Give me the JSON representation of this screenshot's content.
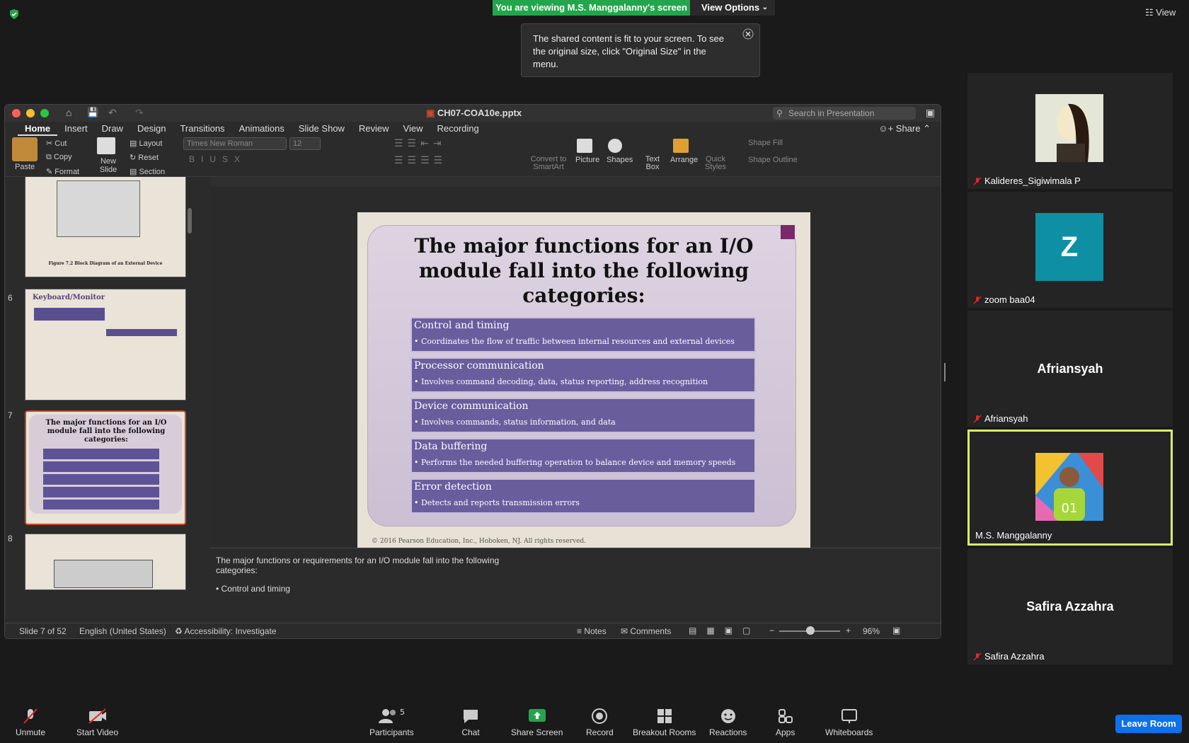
{
  "zoom": {
    "banner": "You are viewing M.S. Manggalanny's screen",
    "view_options": "View Options",
    "tip": "The shared content is fit to your screen. To see the original size, click \"Original Size\" in the menu.",
    "view": "View",
    "participants": [
      {
        "name": "Kalideres_Sigiwimala P",
        "type": "photo",
        "muted": true
      },
      {
        "name": "zoom baa04",
        "type": "letter",
        "letter": "Z",
        "color": "#0e8fa3",
        "muted": true
      },
      {
        "name": "Afriansyah",
        "type": "text",
        "muted": true
      },
      {
        "name": "M.S. Manggalanny",
        "type": "photo",
        "muted": false,
        "active": true
      },
      {
        "name": "Safira Azzahra",
        "type": "text",
        "muted": true
      }
    ],
    "toolbar": {
      "unmute": "Unmute",
      "start_video": "Start Video",
      "participants": "Participants",
      "participants_count": "5",
      "chat": "Chat",
      "share_screen": "Share Screen",
      "record": "Record",
      "breakout": "Breakout Rooms",
      "reactions": "Reactions",
      "apps": "Apps",
      "whiteboards": "Whiteboards",
      "leave": "Leave Room"
    }
  },
  "ppt": {
    "title": "CH07-COA10e.pptx",
    "search_placeholder": "Search in Presentation",
    "share": "Share",
    "tabs": [
      "Home",
      "Insert",
      "Draw",
      "Design",
      "Transitions",
      "Animations",
      "Slide Show",
      "Review",
      "View",
      "Recording"
    ],
    "ribbon": {
      "paste": "Paste",
      "cut": "Cut",
      "copy": "Copy",
      "format": "Format",
      "new_slide": "New Slide",
      "layout": "Layout",
      "reset": "Reset",
      "section": "Section",
      "font": "Times New Roman",
      "size": "12",
      "convert": "Convert to SmartArt",
      "picture": "Picture",
      "shapes": "Shapes",
      "textbox": "Text Box",
      "arrange": "Arrange",
      "quick_styles": "Quick Styles",
      "shape_fill": "Shape Fill",
      "shape_outline": "Shape Outline"
    },
    "thumbs": [
      {
        "num": "",
        "caption": "Figure 7.2  Block Diagram of an External Device"
      },
      {
        "num": "6",
        "caption": "Keyboard/Monitor"
      },
      {
        "num": "7",
        "caption": "The major functions for an I/O module fall into the following categories:"
      },
      {
        "num": "8",
        "caption": ""
      }
    ],
    "slide": {
      "title": "The major functions for an I/O module fall into the following categories:",
      "items": [
        {
          "heading": "Control and timing",
          "body": "• Coordinates the flow of traffic between internal resources and external devices"
        },
        {
          "heading": "Processor communication",
          "body": "• Involves command decoding, data, status reporting, address recognition"
        },
        {
          "heading": "Device communication",
          "body": "• Involves commands, status information, and data"
        },
        {
          "heading": "Data buffering",
          "body": "• Performs the needed buffering operation to balance device and memory speeds"
        },
        {
          "heading": "Error detection",
          "body": "• Detects and reports transmission errors"
        }
      ],
      "copyright": "© 2016 Pearson Education, Inc., Hoboken, NJ. All rights reserved."
    },
    "notes": {
      "line1": "The major functions or requirements for an I/O module fall into the following",
      "line2": "categories:",
      "line3": "• Control and timing"
    },
    "status": {
      "slide": "Slide 7 of 52",
      "lang": "English (United States)",
      "access": "Accessibility: Investigate",
      "notes": "Notes",
      "comments": "Comments",
      "zoom": "96%"
    }
  }
}
